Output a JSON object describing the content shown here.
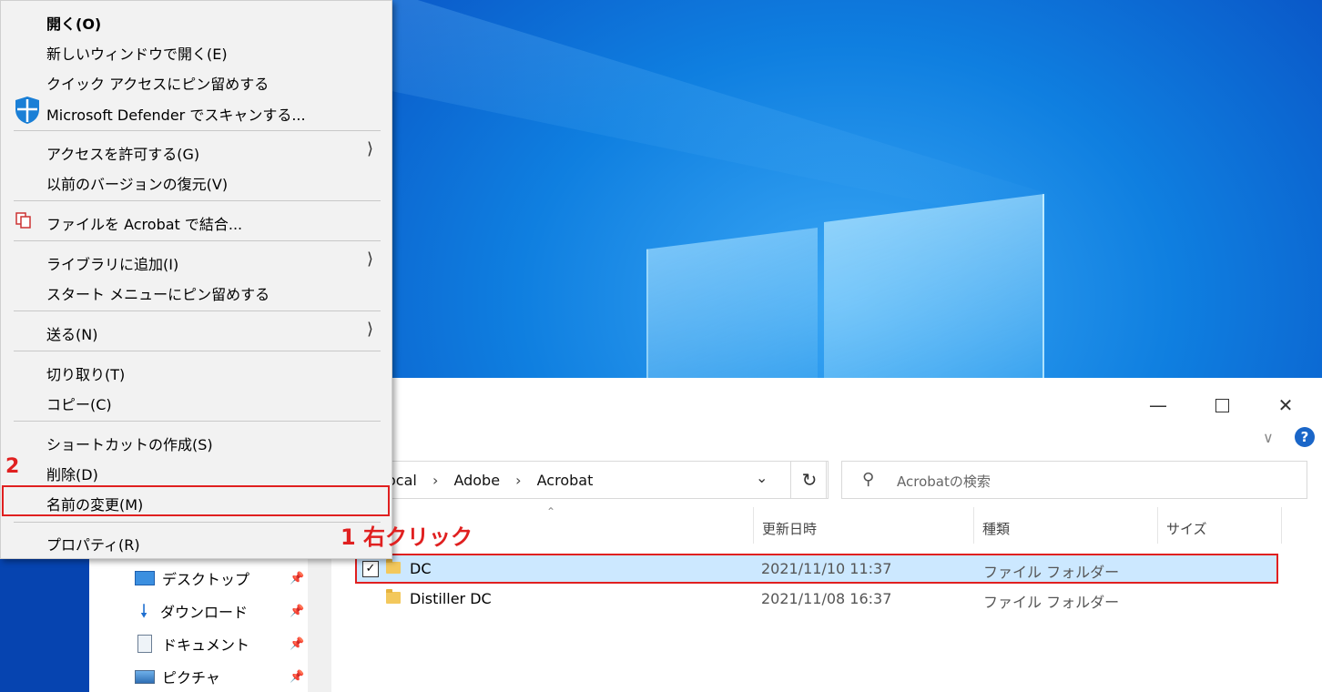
{
  "context_menu": {
    "items": [
      {
        "label": "開く(O)"
      },
      {
        "label": "新しいウィンドウで開く(E)"
      },
      {
        "label": "クイック アクセスにピン留めする"
      },
      {
        "label": "Microsoft Defender でスキャンする..."
      },
      {
        "label": "アクセスを許可する(G)"
      },
      {
        "label": "以前のバージョンの復元(V)"
      },
      {
        "label": "ファイルを Acrobat で結合..."
      },
      {
        "label": "ライブラリに追加(I)"
      },
      {
        "label": "スタート メニューにピン留めする"
      },
      {
        "label": "送る(N)"
      },
      {
        "label": "切り取り(T)"
      },
      {
        "label": "コピー(C)"
      },
      {
        "label": "ショートカットの作成(S)"
      },
      {
        "label": "削除(D)"
      },
      {
        "label": "名前の変更(M)"
      },
      {
        "label": "プロパティ(R)"
      }
    ]
  },
  "annotations": {
    "step1": "1 右クリック",
    "step2": "2"
  },
  "explorer": {
    "breadcrumb": [
      "ocal",
      "Adobe",
      "Acrobat"
    ],
    "search_placeholder": "Acrobatの検索",
    "columns": [
      "更新日時",
      "種類",
      "サイズ"
    ],
    "rows": [
      {
        "name": "DC",
        "date": "2021/11/10 11:37",
        "type": "ファイル フォルダー",
        "selected": true
      },
      {
        "name": "Distiller DC",
        "date": "2021/11/08 16:37",
        "type": "ファイル フォルダー",
        "selected": false
      }
    ],
    "nav_items": [
      {
        "label": "デスクトップ",
        "icon": "desktop-icon"
      },
      {
        "label": "ダウンロード",
        "icon": "download-icon"
      },
      {
        "label": "ドキュメント",
        "icon": "document-icon"
      },
      {
        "label": "ピクチャ",
        "icon": "pictures-icon"
      }
    ],
    "help_label": "?"
  },
  "colors": {
    "highlight_red": "#e02020",
    "selection_blue": "#cce8ff",
    "accent": "#1a66c8"
  }
}
